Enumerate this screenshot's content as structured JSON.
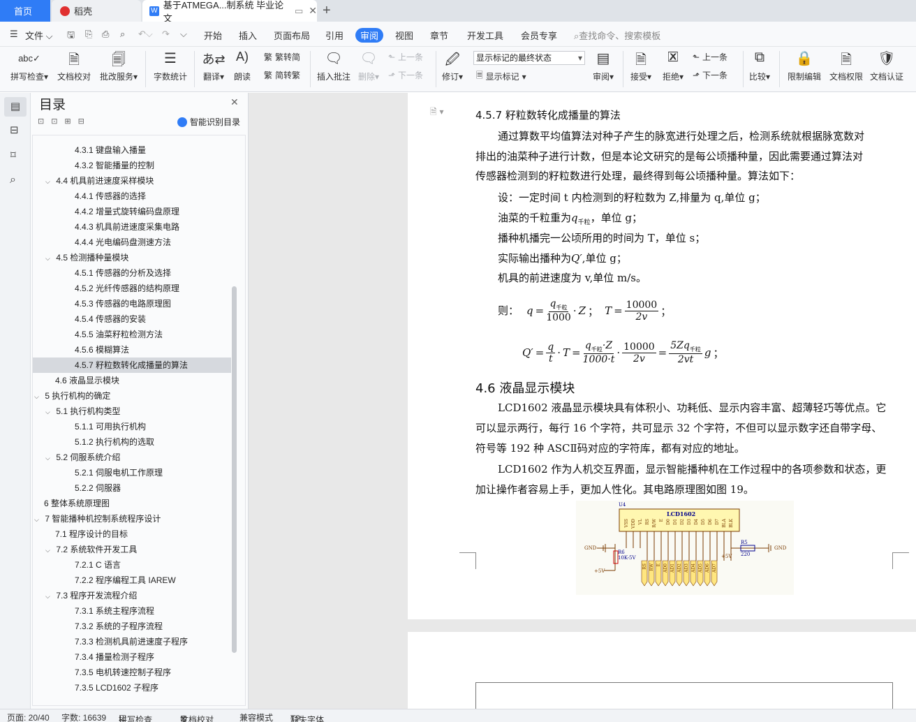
{
  "tabs": {
    "home": "首页",
    "docer": "稻壳",
    "document": "基于ATMEGA...制系统 毕业论文",
    "add": "+"
  },
  "menu": {
    "file": "文件",
    "items": [
      "开始",
      "插入",
      "页面布局",
      "引用",
      "审阅",
      "视图",
      "章节",
      "开发工具",
      "会员专享"
    ],
    "search": "查找命令、搜索模板"
  },
  "ribbon": {
    "spell": "拼写检查",
    "proof": "文档校对",
    "annotate": "批改服务",
    "wordcount": "字数统计",
    "translate": "翻译",
    "read": "朗读",
    "to_trad": "繁转简",
    "to_simp": "简转繁",
    "insert_comment": "插入批注",
    "delete": "删除",
    "prev": "上一条",
    "next": "下一条",
    "track": "修订",
    "markup_select": "显示标记的最终状态",
    "show_markup": "显示标记",
    "review": "审阅",
    "accept": "接受",
    "reject": "拒绝",
    "prev2": "上一条",
    "next2": "下一条",
    "compare": "比较",
    "restrict": "限制编辑",
    "permission": "文档权限",
    "certify": "文档认证"
  },
  "toc": {
    "title": "目录",
    "smart": "智能识别目录",
    "items": [
      {
        "text": "4.3.1  键盘输入播量",
        "level": 3
      },
      {
        "text": "4.3.2  智能播量的控制",
        "level": 3
      },
      {
        "text": "4.4  机具前进速度采样模块",
        "level": 2,
        "open": true
      },
      {
        "text": "4.4.1  传感器的选择",
        "level": 3
      },
      {
        "text": "4.4.2    增量式旋转编码盘原理",
        "level": 3
      },
      {
        "text": "4.4.3  机具前进速度采集电路",
        "level": 3
      },
      {
        "text": "4.4.4  光电编码盘测速方法",
        "level": 3
      },
      {
        "text": "4.5  检测播种量模块",
        "level": 2,
        "open": true
      },
      {
        "text": "4.5.1  传感器的分析及选择",
        "level": 3
      },
      {
        "text": "4.5.2  光纤传感器的结构原理",
        "level": 3
      },
      {
        "text": "4.5.3  传感器的电路原理图",
        "level": 3
      },
      {
        "text": "4.5.4  传感器的安装",
        "level": 3
      },
      {
        "text": "4.5.5  油菜籽粒检测方法",
        "level": 3
      },
      {
        "text": "4.5.6  模糊算法",
        "level": 3
      },
      {
        "text": "4.5.7  籽粒数转化成播量的算法",
        "level": 3,
        "selected": true
      },
      {
        "text": "4.6  液晶显示模块",
        "level": 2
      },
      {
        "text": "5  执行机构的确定",
        "level": 1,
        "open": true
      },
      {
        "text": "5.1 执行机构类型",
        "level": 2,
        "open": true
      },
      {
        "text": "5.1.1 可用执行机构",
        "level": 3
      },
      {
        "text": "5.1.2  执行机构的选取",
        "level": 3
      },
      {
        "text": "5.2  伺服系统介绍",
        "level": 2,
        "open": true
      },
      {
        "text": "5.2.1  伺服电机工作原理",
        "level": 3
      },
      {
        "text": "5.2.2 伺服器",
        "level": 3
      },
      {
        "text": "6  整体系统原理图",
        "level": 1
      },
      {
        "text": "7  智能播种机控制系统程序设计",
        "level": 1,
        "open": true
      },
      {
        "text": "7.1  程序设计的目标",
        "level": 2
      },
      {
        "text": "7.2  系统软件开发工具",
        "level": 2,
        "open": true
      },
      {
        "text": "7.2.1 C 语言",
        "level": 3
      },
      {
        "text": "7.2.2  程序编程工具 IAREW",
        "level": 3
      },
      {
        "text": "7.3  程序开发流程介绍",
        "level": 2,
        "open": true
      },
      {
        "text": "7.3.1  系统主程序流程",
        "level": 3
      },
      {
        "text": "7.3.2  系统的子程序流程",
        "level": 3
      },
      {
        "text": "7.3.3  检测机具前进速度子程序",
        "level": 3
      },
      {
        "text": "7.3.4  播量检测子程序",
        "level": 3
      },
      {
        "text": "7.3.5  电机转速控制子程序",
        "level": 3
      },
      {
        "text": "7.3.5 LCD1602 子程序",
        "level": 3
      }
    ]
  },
  "doc": {
    "h457": "4.5.7  籽粒数转化成播量的算法",
    "p1a": "通过算数平均值算法对种子产生的脉宽进行处理之后，检测系统就根据脉宽数对",
    "p1b": "排出的油菜种子进行计数，但是本论文研究的是每公顷播种量，因此需要通过算法对",
    "p1c": "传感器检测到的籽粒数进行处理，最终得到每公顷播种量。算法如下：",
    "l1": "设：一定时间 t 内检测到的籽粒数为 Z,排量为 q,单位 g；",
    "l2a": "油菜的千粒重为",
    "l2b": "，单位 g；",
    "l3": "播种机播完一公顷所用的时间为 T，单位 s；",
    "l4a": "实际输出播种为",
    "l4b": ",单位 g；",
    "l5": "机具的前进速度为 v,单位 m/s。",
    "then": "则：",
    "h46": "4.6  液晶显示模块",
    "p2a": "LCD1602 液晶显示模块具有体积小、功耗低、显示内容丰富、超薄轻巧等优点。它",
    "p2b": "可以显示两行，每行 16 个字符，共可显示 32 个字符，不但可以显示数字还自带字母、",
    "p2c": "符号等 192 种 ASCⅡ码对应的字符库，都有对应的地址。",
    "p3a": "LCD1602 作为人机交互界面，显示智能播种机在工作过程中的各项参数和状态，更",
    "p3b": "加让操作者容易上手，更加人性化。其电路原理图如图 19。"
  },
  "formula": {
    "q": "q",
    "q_sub": "千粒",
    "Qp": "Q′",
    "Z": "Z",
    "T": "T",
    "n10000": "10000",
    "n1000": "1000",
    "d2v": "2v",
    "t": "t",
    "d1000t": "1000·t",
    "fiveZq": "5Zq",
    "d2vt": "2vt",
    "g": "g"
  },
  "circuit": {
    "chip": "U4",
    "model": "LCD1602",
    "pins": [
      "VSS",
      "VDD",
      "VL",
      "RS",
      "R/W",
      "E",
      "D0",
      "D1",
      "D2",
      "D3",
      "D4",
      "D5",
      "D6",
      "D7",
      "BLA",
      "BLK"
    ],
    "gnd_left": "GND",
    "gnd_right": "GND",
    "r6": "R6",
    "r6_val": "10K-5V",
    "plus5": "+5V",
    "plus5b": "+5V",
    "r5": "R5",
    "r5_val": "220",
    "bus": [
      "RS",
      "RW",
      "E",
      "AD0",
      "AD1",
      "AD2",
      "AD3",
      "AD4",
      "AD5",
      "AD6",
      "AD7"
    ]
  },
  "status": {
    "page": "页面: 20/40",
    "words": "字数: 16639",
    "spell": "拼写检查",
    "proof": "文档校对",
    "compat": "兼容模式",
    "font": "缺失字体"
  },
  "colors": {
    "accent": "#2f7cf6",
    "selected": "#d6d9de"
  }
}
